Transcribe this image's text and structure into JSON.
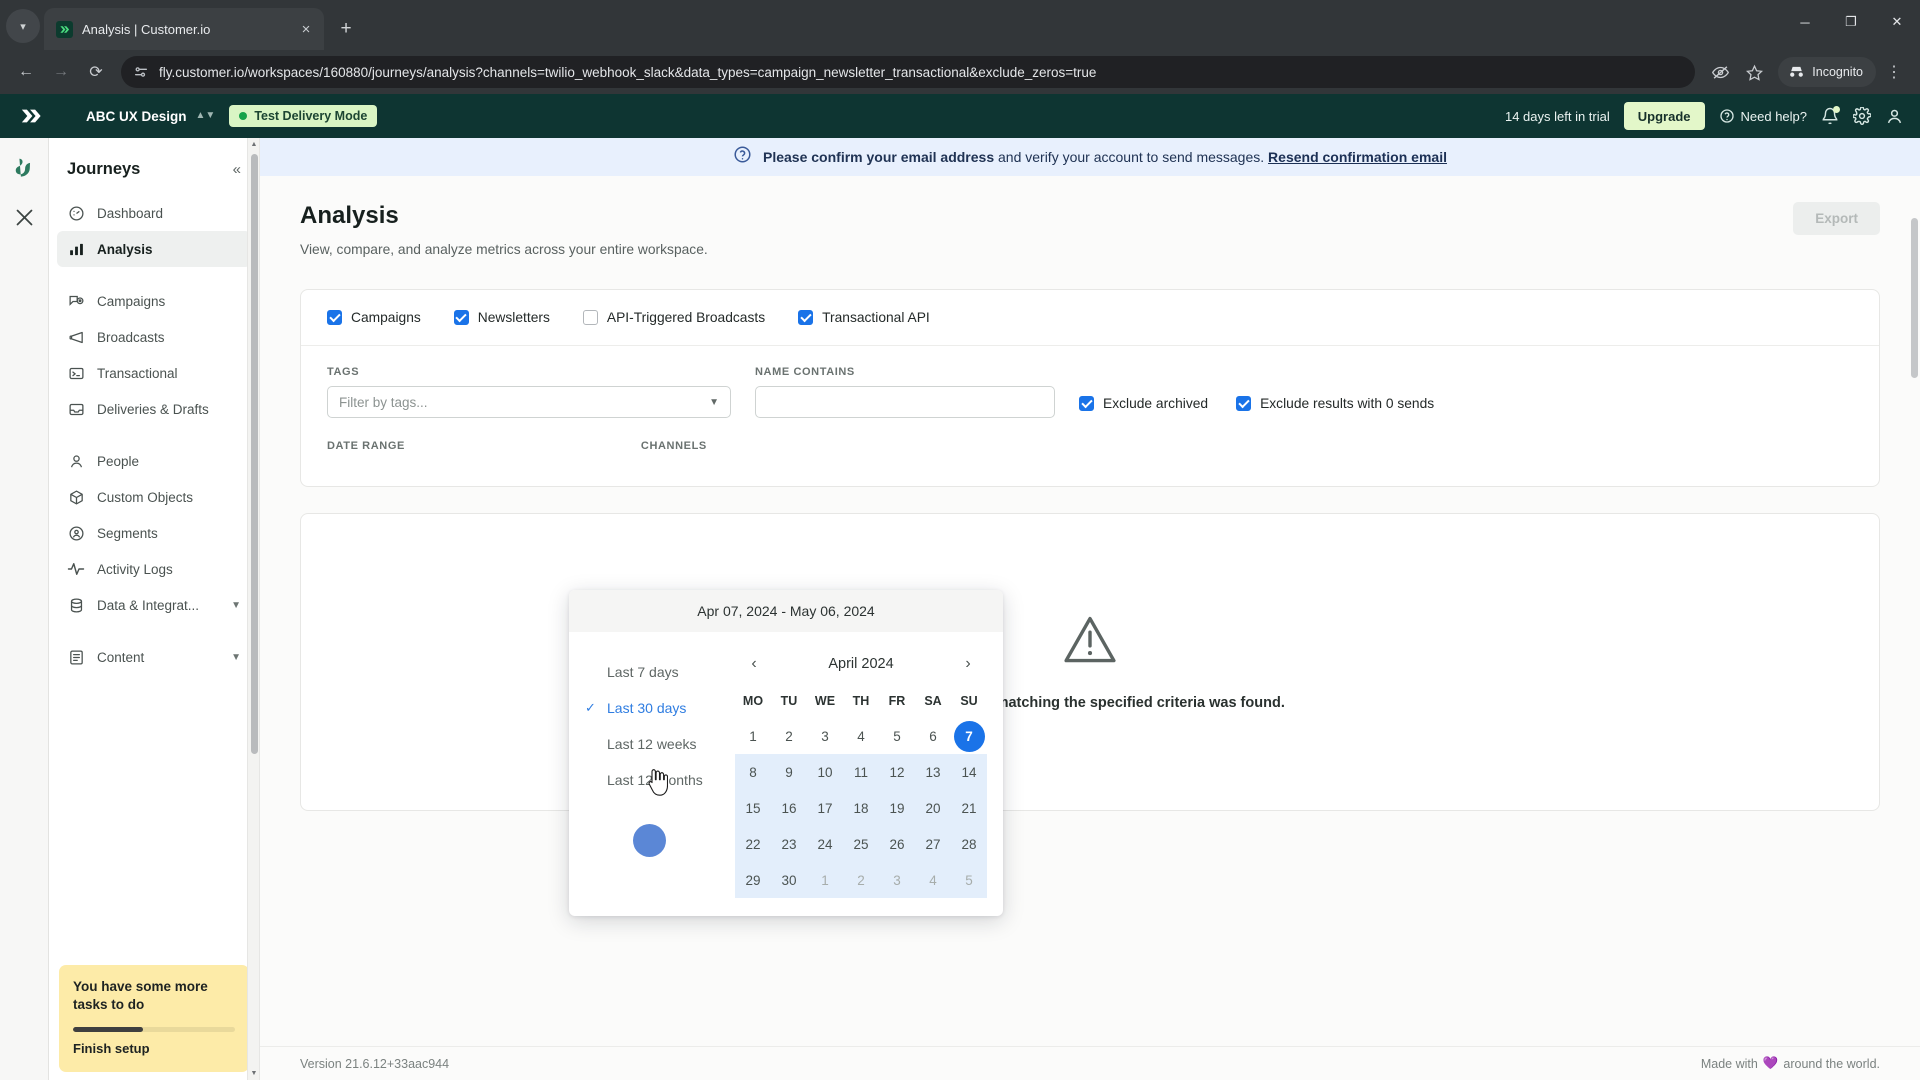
{
  "browser": {
    "tab_title": "Analysis | Customer.io",
    "url": "fly.customer.io/workspaces/160880/journeys/analysis?channels=twilio_webhook_slack&data_types=campaign_newsletter_transactional&exclude_zeros=true",
    "incognito_label": "Incognito",
    "new_tab_label": "+",
    "close_tab_label": "×",
    "minimize_label": "─",
    "maximize_label": "❐",
    "window_close_label": "✕"
  },
  "appbar": {
    "workspace": "ABC UX Design",
    "test_mode": "Test Delivery Mode",
    "trial": "14 days left in trial",
    "upgrade": "Upgrade",
    "need_help": "Need help?"
  },
  "notice": {
    "bold": "Please confirm your email address",
    "rest": " and verify your account to send messages. ",
    "link": "Resend confirmation email"
  },
  "sidebar": {
    "title": "Journeys",
    "items": [
      {
        "label": "Dashboard",
        "icon": "gauge-icon"
      },
      {
        "label": "Analysis",
        "icon": "bar-chart-icon"
      },
      {
        "label": "Campaigns",
        "icon": "campaign-icon"
      },
      {
        "label": "Broadcasts",
        "icon": "megaphone-icon"
      },
      {
        "label": "Transactional",
        "icon": "terminal-icon"
      },
      {
        "label": "Deliveries & Drafts",
        "icon": "inbox-icon"
      },
      {
        "label": "People",
        "icon": "person-icon"
      },
      {
        "label": "Custom Objects",
        "icon": "cube-icon"
      },
      {
        "label": "Segments",
        "icon": "segment-icon"
      },
      {
        "label": "Activity Logs",
        "icon": "pulse-icon"
      },
      {
        "label": "Data & Integrat...",
        "icon": "database-icon"
      },
      {
        "label": "Content",
        "icon": "content-icon"
      }
    ],
    "task_card": {
      "title": "You have some more tasks to do",
      "progress_pct": 43,
      "link": "Finish setup"
    }
  },
  "page": {
    "title": "Analysis",
    "subtitle": "View, compare, and analyze metrics across your entire workspace.",
    "export": "Export"
  },
  "filters": {
    "types": [
      {
        "label": "Campaigns",
        "checked": true
      },
      {
        "label": "Newsletters",
        "checked": true
      },
      {
        "label": "API-Triggered Broadcasts",
        "checked": false
      },
      {
        "label": "Transactional API",
        "checked": true
      }
    ],
    "tags_label": "TAGS",
    "tags_placeholder": "Filter by tags...",
    "name_label": "NAME CONTAINS",
    "name_value": "",
    "date_range_label": "DATE RANGE",
    "channels_label": "CHANNELS",
    "exclude_archived": "Exclude archived",
    "exclude_archived_checked": true,
    "exclude_zero": "Exclude results with 0 sends",
    "exclude_zero_checked": true
  },
  "date_picker": {
    "range_header": "Apr 07, 2024 - May 06, 2024",
    "presets": [
      {
        "label": "Last 7 days",
        "selected": false
      },
      {
        "label": "Last 30 days",
        "selected": true
      },
      {
        "label": "Last 12 weeks",
        "selected": false
      },
      {
        "label": "Last 12 months",
        "selected": false
      }
    ],
    "month": "April 2024",
    "prev": "‹",
    "next": "›",
    "dow": [
      "MO",
      "TU",
      "WE",
      "TH",
      "FR",
      "SA",
      "SU"
    ],
    "weeks": [
      [
        {
          "d": "1"
        },
        {
          "d": "2"
        },
        {
          "d": "3"
        },
        {
          "d": "4"
        },
        {
          "d": "5"
        },
        {
          "d": "6"
        },
        {
          "d": "7",
          "state": "start"
        }
      ],
      [
        {
          "d": "8",
          "state": "inrange"
        },
        {
          "d": "9",
          "state": "inrange"
        },
        {
          "d": "10",
          "state": "inrange"
        },
        {
          "d": "11",
          "state": "inrange"
        },
        {
          "d": "12",
          "state": "inrange"
        },
        {
          "d": "13",
          "state": "inrange"
        },
        {
          "d": "14",
          "state": "inrange"
        }
      ],
      [
        {
          "d": "15",
          "state": "inrange"
        },
        {
          "d": "16",
          "state": "inrange"
        },
        {
          "d": "17",
          "state": "inrange"
        },
        {
          "d": "18",
          "state": "inrange"
        },
        {
          "d": "19",
          "state": "inrange"
        },
        {
          "d": "20",
          "state": "inrange"
        },
        {
          "d": "21",
          "state": "inrange"
        }
      ],
      [
        {
          "d": "22",
          "state": "inrange"
        },
        {
          "d": "23",
          "state": "inrange"
        },
        {
          "d": "24",
          "state": "inrange"
        },
        {
          "d": "25",
          "state": "inrange"
        },
        {
          "d": "26",
          "state": "inrange"
        },
        {
          "d": "27",
          "state": "inrange"
        },
        {
          "d": "28",
          "state": "inrange"
        }
      ],
      [
        {
          "d": "29",
          "state": "inrange"
        },
        {
          "d": "30",
          "state": "inrange"
        },
        {
          "d": "1",
          "state": "inrange muted"
        },
        {
          "d": "2",
          "state": "inrange muted"
        },
        {
          "d": "3",
          "state": "inrange muted"
        },
        {
          "d": "4",
          "state": "inrange muted"
        },
        {
          "d": "5",
          "state": "inrange muted"
        }
      ]
    ],
    "apply_label": ""
  },
  "empty_state": {
    "message": "Sorry, no data matching the specified criteria was found."
  },
  "footer": {
    "version": "Version 21.6.12+33aac944",
    "made_with_pre": "Made with",
    "made_with_post": "around the world."
  },
  "colors": {
    "brand_dark": "#0e3532",
    "accent_blue": "#1a73e8",
    "notice_bg": "#e8f0fd",
    "task_yellow": "#fdeba8",
    "range_blue": "#e3eefb"
  }
}
